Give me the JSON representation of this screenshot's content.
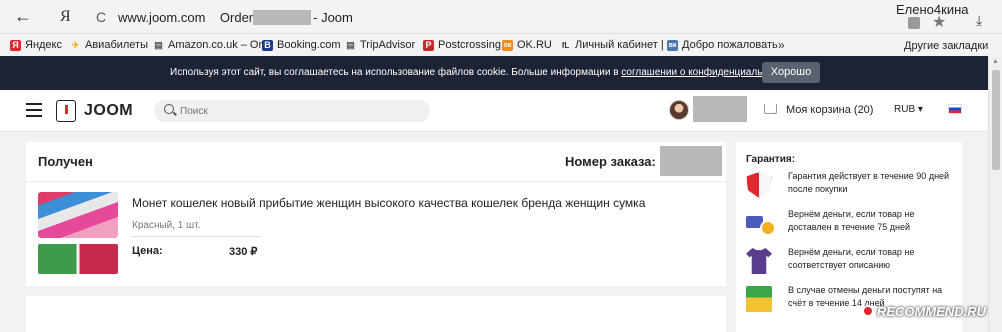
{
  "browser": {
    "back_glyph": "←",
    "yandex_glyph": "Я",
    "refresh_glyph": "C",
    "url_domain": "www.joom.com",
    "url_prefix": "Order",
    "url_suffix": "- Joom",
    "user_name": "Елено4кина",
    "star_glyph": "★",
    "download_glyph": "⤓"
  },
  "bookmarks": [
    {
      "label": "Яндекс",
      "icon": "yandex-icon",
      "color": "#e0262e",
      "glyph": "Я"
    },
    {
      "label": "Авиабилеты",
      "icon": "plane-icon",
      "color": "#333333",
      "glyph": "✈"
    },
    {
      "label": "Amazon.co.uk – Or",
      "icon": "amazon-icon",
      "color": "#555555",
      "glyph": "▤"
    },
    {
      "label": "Booking.com",
      "icon": "booking-icon",
      "color": "#1b3a8c",
      "glyph": "B"
    },
    {
      "label": "TripAdvisor",
      "icon": "tripadvisor-icon",
      "color": "#555555",
      "glyph": "▤"
    },
    {
      "label": "Postcrossing",
      "icon": "postcrossing-icon",
      "color": "#c62a2a",
      "glyph": "P"
    },
    {
      "label": "OK.RU",
      "icon": "ok-icon",
      "color": "#f08c1e",
      "glyph": "ок"
    },
    {
      "label": "Личный кабинет |",
      "icon": "cabinet-icon",
      "color": "#444444",
      "glyph": "fL"
    },
    {
      "label": "Добро пожаловать",
      "icon": "vk-icon",
      "color": "#4a76a8",
      "glyph": "вк"
    }
  ],
  "bookmarks_more": "»",
  "bookmarks_other": "Другие закладки",
  "cookie": {
    "text_before": "Используя этот сайт, вы соглашаетесь на использование файлов cookie. Больше информации в ",
    "link": "соглашении о конфиденциальности",
    "text_after": ".",
    "button": "Хорошо"
  },
  "header": {
    "logo": "JOOM",
    "search_placeholder": "Поиск",
    "cart": "Моя корзина (20)",
    "currency": "RUB ▾"
  },
  "order": {
    "status": "Получен",
    "number_label": "Номер заказа:",
    "product_title": "Монет кошелек новый прибытие женщин высокого качества кошелек бренда женщин сумка",
    "variant": "Красный, 1 шт.",
    "price_label": "Цена:",
    "price": "330 ₽"
  },
  "guarantee": {
    "title": "Гарантия:",
    "items": [
      {
        "icon": "shield-icon",
        "text": "Гарантия действует в течение 90 дней после покупки"
      },
      {
        "icon": "delivery-icon",
        "text": "Вернём деньги, если товар не доставлен в течение 75 дней"
      },
      {
        "icon": "shirt-icon",
        "text": "Вернём деньги, если товар не соответствует описанию"
      },
      {
        "icon": "money-icon",
        "text": "В случае отмены деньги поступят на счёт в течение 14 дней"
      }
    ]
  },
  "watermark": "RECOMMEND.RU"
}
